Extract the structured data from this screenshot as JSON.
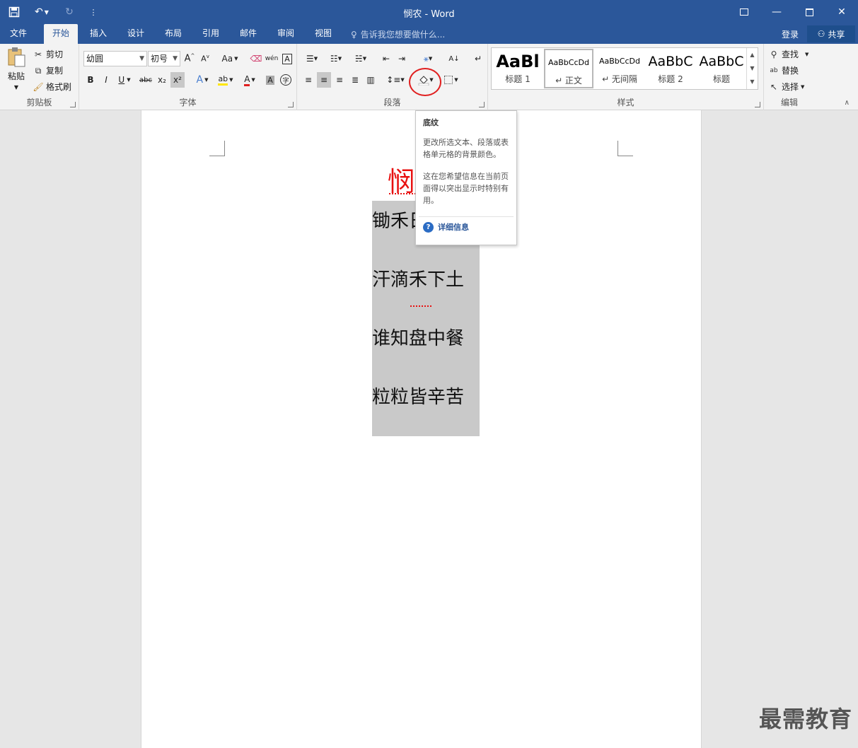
{
  "window": {
    "title": "悯农 - Word",
    "qat_customize": "⋮"
  },
  "tabs": [
    "文件",
    "开始",
    "插入",
    "设计",
    "布局",
    "引用",
    "邮件",
    "审阅",
    "视图"
  ],
  "tell_me": "告诉我您想要做什么...",
  "account": {
    "login": "登录",
    "share": "共享"
  },
  "clipboard": {
    "paste": "粘贴",
    "cut": "剪切",
    "copy": "复制",
    "format_painter": "格式刷",
    "label": "剪贴板"
  },
  "font": {
    "name": "幼圆",
    "size": "初号",
    "change_case": "Aa",
    "bold": "B",
    "italic": "I",
    "underline": "U",
    "strike": "abc",
    "subscript": "x₂",
    "superscript": "x²",
    "label": "字体"
  },
  "paragraph": {
    "label": "段落"
  },
  "styles": {
    "items": [
      {
        "preview": "AaBl",
        "name": "标题 1"
      },
      {
        "preview": "AaBbCcDd",
        "name": "↵ 正文"
      },
      {
        "preview": "AaBbCcDd",
        "name": "↵ 无间隔"
      },
      {
        "preview": "AaBbC",
        "name": "标题 2"
      },
      {
        "preview": "AaBbC",
        "name": "标题"
      }
    ],
    "label": "样式"
  },
  "editing": {
    "find": "查找",
    "replace": "替换",
    "select": "选择",
    "label": "编辑"
  },
  "tooltip": {
    "title": "底纹",
    "description": "更改所选文本、段落或表格单元格的背景颜色。",
    "hint": "这在您希望信息在当前页面得以突出显示时特别有用。",
    "more": "详细信息"
  },
  "document": {
    "title": "悯",
    "lines": [
      "锄禾日",
      "汗滴禾下土",
      "谁知盘中餐",
      "粒粒皆辛苦"
    ]
  },
  "watermark": "最需教育"
}
